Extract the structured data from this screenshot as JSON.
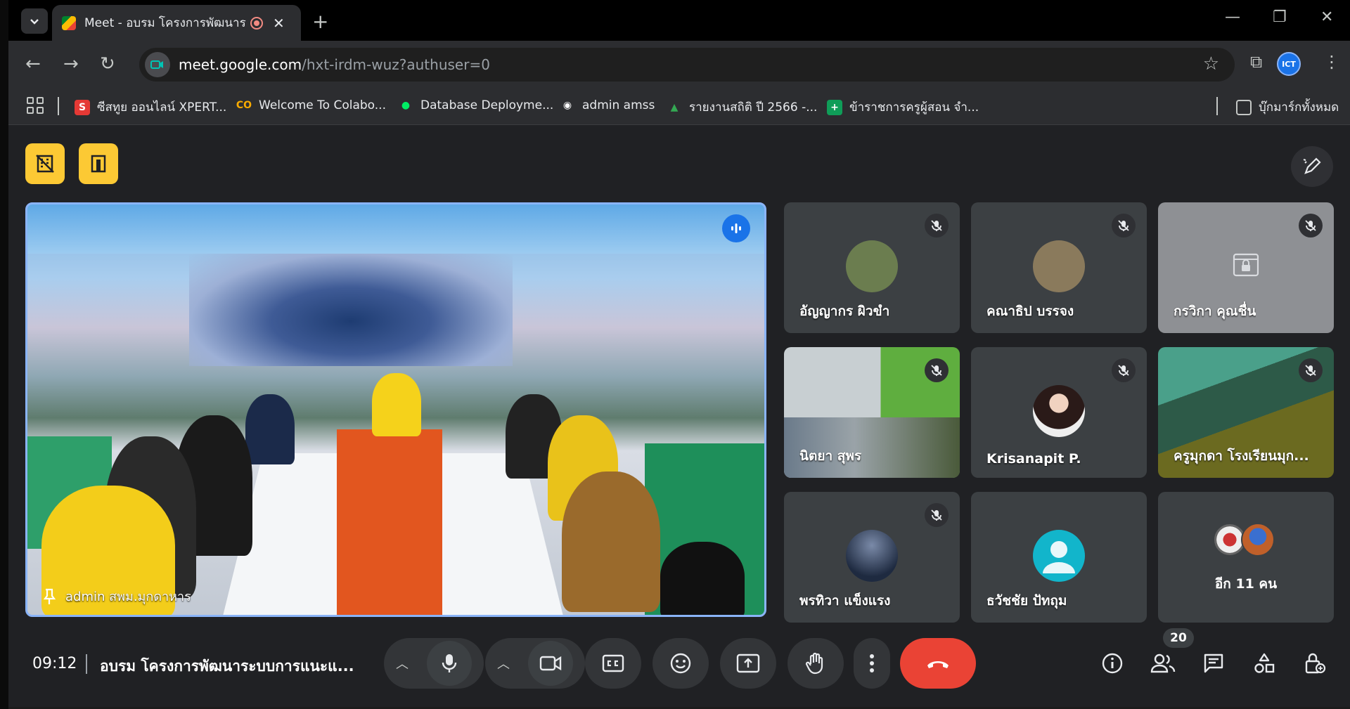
{
  "browser": {
    "tab_title": "Meet - อบรม โครงการพัฒนาระ",
    "tab_close": "✕",
    "new_tab": "+",
    "url_host": "meet.google.com",
    "url_path": "/hxt-irdm-wuz?authuser=0",
    "profile_label": "ICT"
  },
  "bookmarks": [
    {
      "label": "ซีสทูย ออนไลน์ XPERT...",
      "icon": "S",
      "color": "#e53935"
    },
    {
      "label": "Welcome To Colabo...",
      "icon": "CO",
      "color": "#f9ab00"
    },
    {
      "label": "Database Deployme...",
      "icon": "●",
      "color": "#00ed64"
    },
    {
      "label": "admin amss",
      "icon": "◉",
      "color": "#ffffff"
    },
    {
      "label": "รายงานสถิติ ปี 2566 -...",
      "icon": "▲",
      "color": "#34a853"
    },
    {
      "label": "ข้าราชการครูผู้สอน จำ...",
      "icon": "+",
      "color": "#0f9d58"
    }
  ],
  "all_bookmarks_label": "บุ๊กมาร์กทั้งหมด",
  "main_video": {
    "participant_name": "admin สพม.มุกดาหาร"
  },
  "participants": [
    {
      "name": "อัญญากร ผิวขำ",
      "avatar_color": "#6b7d4f"
    },
    {
      "name": "คณาธิป บรรจง",
      "avatar_color": "#8a7a5c"
    },
    {
      "name": "กรวิกา คุณชื่น",
      "avatar_color": "#8a8c90"
    },
    {
      "name": "นิตยา สุพร",
      "avatar_color": "#7c8a6a"
    },
    {
      "name": "Krisanapit P.",
      "avatar_color": "#5b4a45"
    },
    {
      "name": "ครูมุกดา โรงเรียนมุก...",
      "avatar_color": "#6a7a5a"
    },
    {
      "name": "พรทิวา แข็งแรง",
      "avatar_color": "#2a3a55"
    },
    {
      "name": "ธวัชชัย ปัทถุม",
      "avatar_color": "#12b5cb"
    }
  ],
  "more_tile": {
    "label": "อีก 11 คน"
  },
  "bottom_bar": {
    "time": "09:12",
    "meeting_title": "อบรม โครงการพัฒนาระบบการแนะแ...",
    "participant_count": "20"
  },
  "colors": {
    "accent": "#8ab4f8",
    "end_call": "#ea4335",
    "host_button": "#fcc934"
  }
}
